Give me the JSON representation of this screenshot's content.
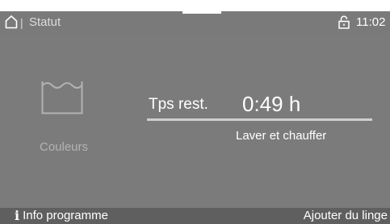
{
  "status_bar": {
    "home_icon": "home-icon",
    "separator": "|",
    "title": "Statut",
    "lock_icon": "lock-icon",
    "time": "11:02"
  },
  "program": {
    "icon": "wash-tub-icon",
    "name": "Couleurs"
  },
  "remaining": {
    "label": "Tps rest.",
    "value": "0:49 h"
  },
  "phase": "Laver et chauffer",
  "footer": {
    "info_icon": "info-icon",
    "info_label": "Info programme",
    "add_laundry_label": "Ajouter du linge"
  },
  "colors": {
    "panel_bg": "#7b7b7b",
    "status_bg": "#7a7a7a",
    "footer_bg": "#5f5f5f",
    "text": "#ffffff",
    "muted_text": "#b3b3b3"
  }
}
